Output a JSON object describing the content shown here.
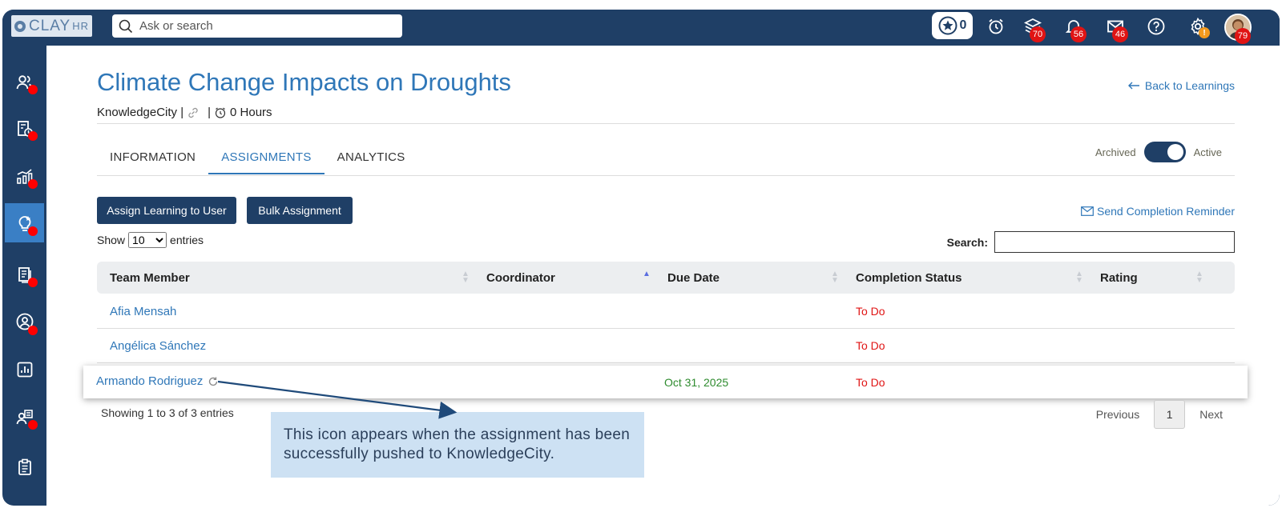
{
  "topbar": {
    "logo_main": "CLAY",
    "logo_suffix": "HR",
    "search_placeholder": "Ask or search",
    "points": "0",
    "badges": {
      "learning": "70",
      "notifications": "56",
      "messages": "46",
      "settings": "!",
      "profile": "79"
    }
  },
  "header": {
    "title": "Climate Change Impacts on Droughts",
    "provider": "KnowledgeCity |",
    "separator": "|",
    "hours": "0 Hours",
    "back_link": "Back to Learnings"
  },
  "tabs": [
    {
      "label": "INFORMATION"
    },
    {
      "label": "ASSIGNMENTS"
    },
    {
      "label": "ANALYTICS"
    }
  ],
  "toggle": {
    "left_label": "Archived",
    "right_label": "Active"
  },
  "actions": {
    "assign_label": "Assign Learning to User",
    "bulk_label": "Bulk Assignment",
    "reminder_label": "Send Completion Reminder"
  },
  "table_controls": {
    "show_label": "Show",
    "entries_value": "10",
    "entries_label": "entries",
    "search_label": "Search:"
  },
  "table": {
    "columns": [
      "Team Member",
      "Coordinator",
      "Due Date",
      "Completion Status",
      "Rating"
    ],
    "rows": [
      {
        "member": "Afia Mensah",
        "coordinator": "",
        "due": "",
        "status": "To Do",
        "rating": ""
      },
      {
        "member": "Angélica Sánchez",
        "coordinator": "",
        "due": "",
        "status": "To Do",
        "rating": ""
      },
      {
        "member": "Armando Rodriguez",
        "coordinator": "",
        "due": "Oct 31, 2025",
        "status": "To Do",
        "rating": ""
      }
    ]
  },
  "footer": {
    "showing": "Showing 1 to 3 of 3 entries",
    "previous": "Previous",
    "page": "1",
    "next": "Next"
  },
  "callout": {
    "text": "This icon appears when the assignment has been successfully pushed to KnowledgeCity."
  },
  "colors": {
    "navy": "#1f3f66",
    "accent": "#2f77b8",
    "todo": "#e01414",
    "due_date": "#2e8b2e",
    "callout_bg": "#cde1f3"
  }
}
